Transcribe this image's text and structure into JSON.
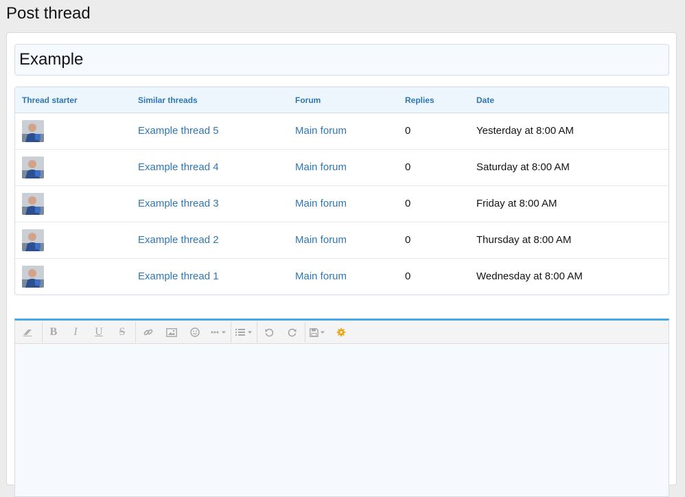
{
  "page": {
    "title": "Post thread"
  },
  "form": {
    "title_value": "Example"
  },
  "similar_threads": {
    "columns": {
      "starter": "Thread starter",
      "title": "Similar threads",
      "forum": "Forum",
      "replies": "Replies",
      "date": "Date"
    },
    "rows": [
      {
        "title": "Example thread 5",
        "forum": "Main forum",
        "replies": "0",
        "date": "Yesterday at 8:00 AM"
      },
      {
        "title": "Example thread 4",
        "forum": "Main forum",
        "replies": "0",
        "date": "Saturday at 8:00 AM"
      },
      {
        "title": "Example thread 3",
        "forum": "Main forum",
        "replies": "0",
        "date": "Friday at 8:00 AM"
      },
      {
        "title": "Example thread 2",
        "forum": "Main forum",
        "replies": "0",
        "date": "Thursday at 8:00 AM"
      },
      {
        "title": "Example thread 1",
        "forum": "Main forum",
        "replies": "0",
        "date": "Wednesday at 8:00 AM"
      }
    ]
  },
  "editor": {
    "toolbar": {
      "bold_label": "B",
      "italic_label": "I",
      "underline_label": "U",
      "strike_label": "S"
    },
    "icons": [
      "eraser-icon",
      "bold-icon",
      "italic-icon",
      "underline-icon",
      "strikethrough-icon",
      "link-icon",
      "image-icon",
      "smilie-icon",
      "more-options-icon",
      "list-icon",
      "undo-icon",
      "redo-icon",
      "save-draft-icon",
      "gear-icon"
    ],
    "body_value": ""
  },
  "colors": {
    "link": "#2e77b3",
    "header_bg": "#edf5fd",
    "editor_accent": "#47a7eb",
    "gear": "#f0a20a"
  }
}
